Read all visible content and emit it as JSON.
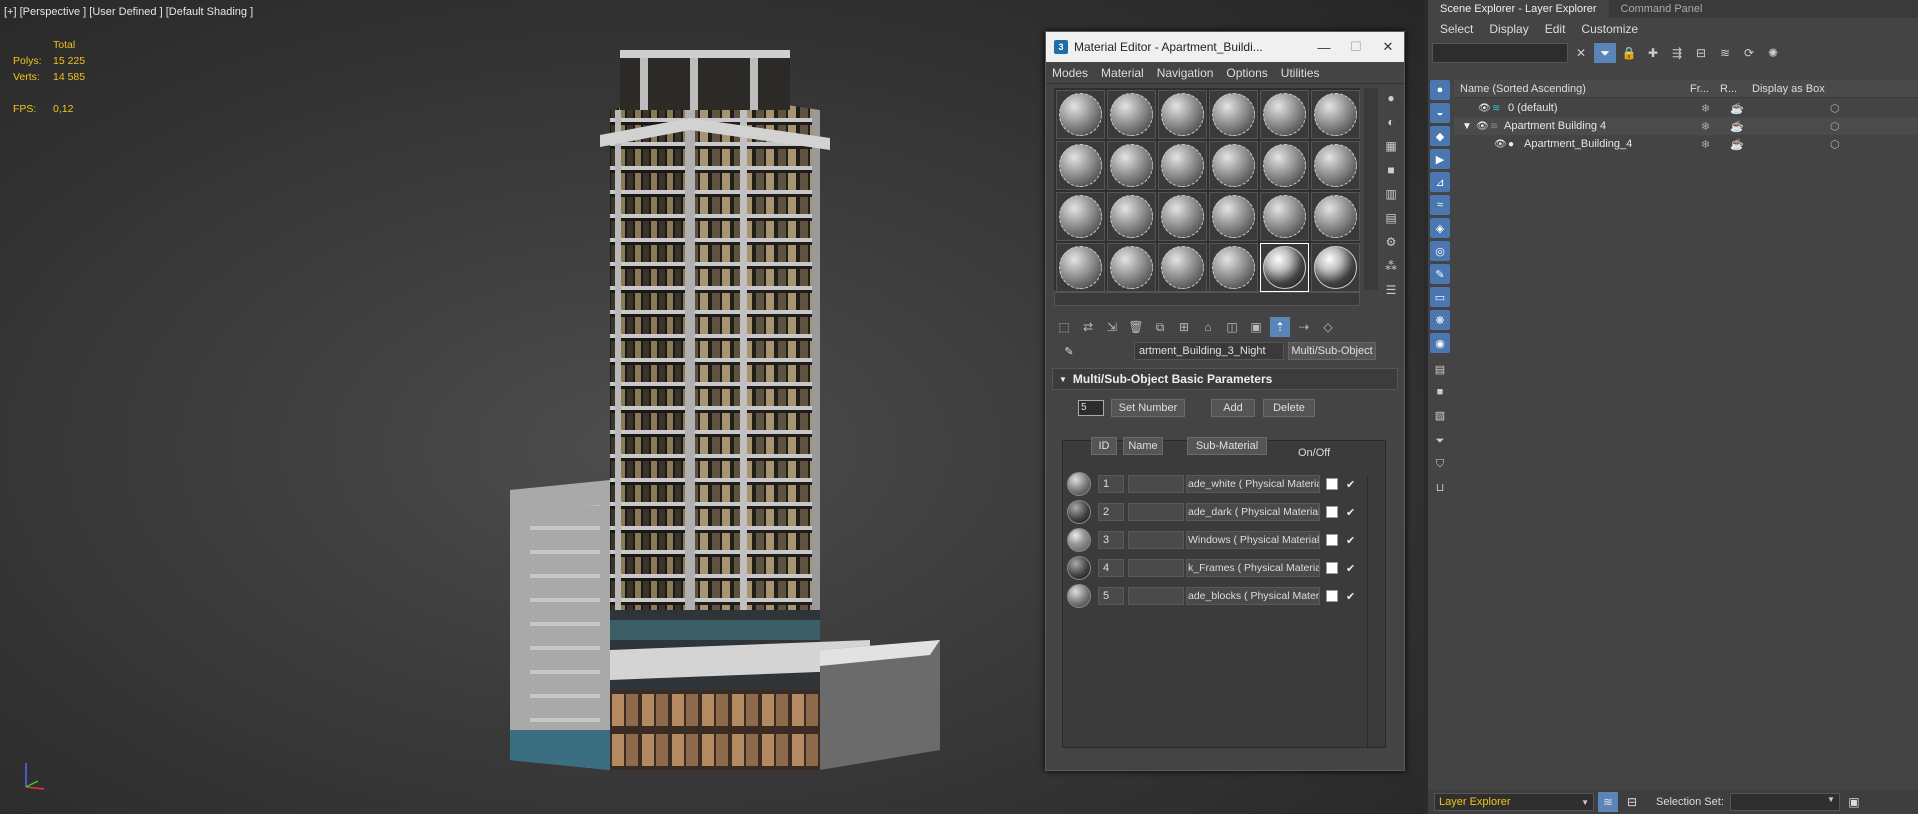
{
  "viewport": {
    "label": "[+] [Perspective ] [User Defined ] [Default Shading ]",
    "stats_total": "Total",
    "polys_label": "Polys:",
    "polys": "15 225",
    "verts_label": "Verts:",
    "verts": "14 585",
    "fps_label": "FPS:",
    "fps": "0,12"
  },
  "material_editor": {
    "title": "Material Editor - Apartment_Buildi...",
    "app_icon": "3",
    "minimize": "—",
    "maximize": "☐",
    "close": "✕",
    "menu": [
      "Modes",
      "Material",
      "Navigation",
      "Options",
      "Utilities"
    ],
    "material_name": "artment_Building_3_Night",
    "material_type": "Multi/Sub-Object",
    "rollout_title": "Multi/Sub-Object Basic Parameters",
    "set_number_value": "5",
    "set_number_label": "Set Number",
    "add_label": "Add",
    "delete_label": "Delete",
    "col_id": "ID",
    "col_name": "Name",
    "col_sub": "Sub-Material",
    "col_onoff": "On/Off",
    "sub_materials": [
      {
        "id": "1",
        "name": "",
        "sub": "ade_white  ( Physical Material )"
      },
      {
        "id": "2",
        "name": "",
        "sub": "ade_dark  ( Physical Material )"
      },
      {
        "id": "3",
        "name": "",
        "sub": "Windows  ( Physical Material )"
      },
      {
        "id": "4",
        "name": "",
        "sub": "k_Frames  ( Physical Material )"
      },
      {
        "id": "5",
        "name": "",
        "sub": "ade_blocks  ( Physical Material )"
      }
    ]
  },
  "scene_explorer": {
    "tab_active": "Scene Explorer - Layer Explorer",
    "tab_inactive": "Command Panel",
    "menu": [
      "Select",
      "Display",
      "Edit",
      "Customize"
    ],
    "col_name": "Name (Sorted Ascending)",
    "col_fr": "Fr...",
    "col_r": "R...",
    "col_box": "Display as Box",
    "rows": [
      {
        "label": "0 (default)"
      },
      {
        "label": "Apartment Building 4"
      },
      {
        "label": "Apartment_Building_4"
      }
    ],
    "layer_explorer": "Layer Explorer",
    "selection_set_label": "Selection Set:"
  }
}
